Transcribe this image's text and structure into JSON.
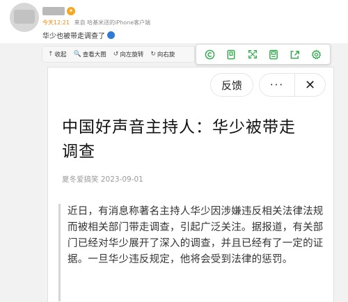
{
  "post": {
    "meta_time": "今天12:21",
    "meta_source": "来自 哈基米送的iPhone客户端",
    "text": "华少也被带走调查了"
  },
  "toolbar": {
    "items": [
      {
        "icon": "↑",
        "label": "收起"
      },
      {
        "icon": "🔍",
        "label": "查看大图"
      },
      {
        "icon": "↺",
        "label": "向左旋转"
      },
      {
        "icon": "↻",
        "label": "向右旋"
      }
    ]
  },
  "ext_toolbar": {
    "icons": [
      "copyright-icon",
      "bookmark-icon",
      "expand-icon",
      "save-icon",
      "share-icon",
      "settings-icon"
    ]
  },
  "reader": {
    "feedback_label": "反馈",
    "more_label": "···",
    "close_label": "✕",
    "title": "中国好声音主持人：华少被带走调查",
    "byline": "夏冬爱搞笑 2023-09-01",
    "body": "近日，有消息称著名主持人华少因涉嫌违反相关法律法规而被相关部门带走调查，引起广泛关注。据报道，有关部门已经对华少展开了深入的调查，并且已经有了一定的证据。一旦华少违反规定，他将会受到法律的惩罚。"
  },
  "colors": {
    "accent_green": "#27a844",
    "meta_orange": "#ff8200"
  }
}
